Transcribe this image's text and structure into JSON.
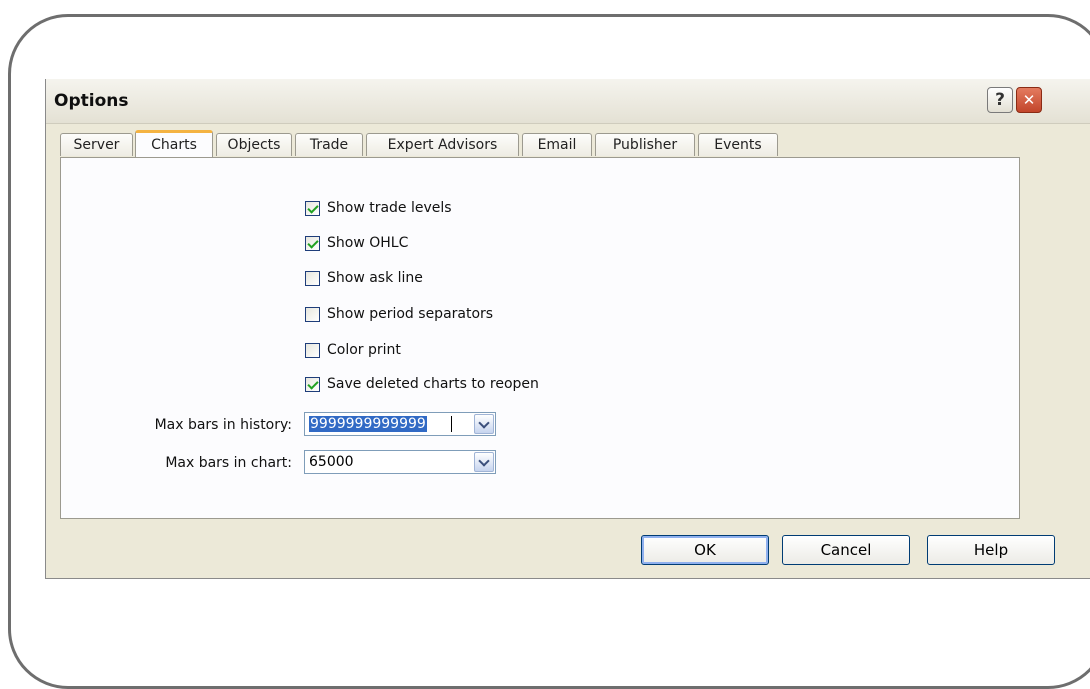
{
  "dialog": {
    "title": "Options",
    "help_glyph": "?",
    "close_glyph": "✕"
  },
  "tabs": [
    {
      "label": "Server",
      "active": false
    },
    {
      "label": "Charts",
      "active": true
    },
    {
      "label": "Objects",
      "active": false
    },
    {
      "label": "Trade",
      "active": false
    },
    {
      "label": "Expert Advisors",
      "active": false
    },
    {
      "label": "Email",
      "active": false
    },
    {
      "label": "Publisher",
      "active": false
    },
    {
      "label": "Events",
      "active": false
    }
  ],
  "checkboxes": [
    {
      "label": "Show trade levels",
      "checked": true
    },
    {
      "label": "Show OHLC",
      "checked": true
    },
    {
      "label": "Show ask line",
      "checked": false
    },
    {
      "label": "Show period separators",
      "checked": false
    },
    {
      "label": "Color print",
      "checked": false
    },
    {
      "label": "Save deleted charts to reopen",
      "checked": true
    }
  ],
  "fields": {
    "max_bars_history": {
      "label": "Max bars in history:",
      "value": "9999999999999"
    },
    "max_bars_chart": {
      "label": "Max bars in chart:",
      "value": "65000"
    }
  },
  "buttons": {
    "ok": "OK",
    "cancel": "Cancel",
    "help": "Help"
  },
  "icons": {
    "help": "help-icon",
    "close": "close-icon",
    "dropdown": "chevron-down-icon",
    "check": "checkmark-icon"
  },
  "colors": {
    "dialog_bg": "#ece9d8",
    "active_tab_accent": "#f4b342",
    "checkmark": "#21a121",
    "selection": "#316ac5",
    "close_button": "#c2452b"
  }
}
